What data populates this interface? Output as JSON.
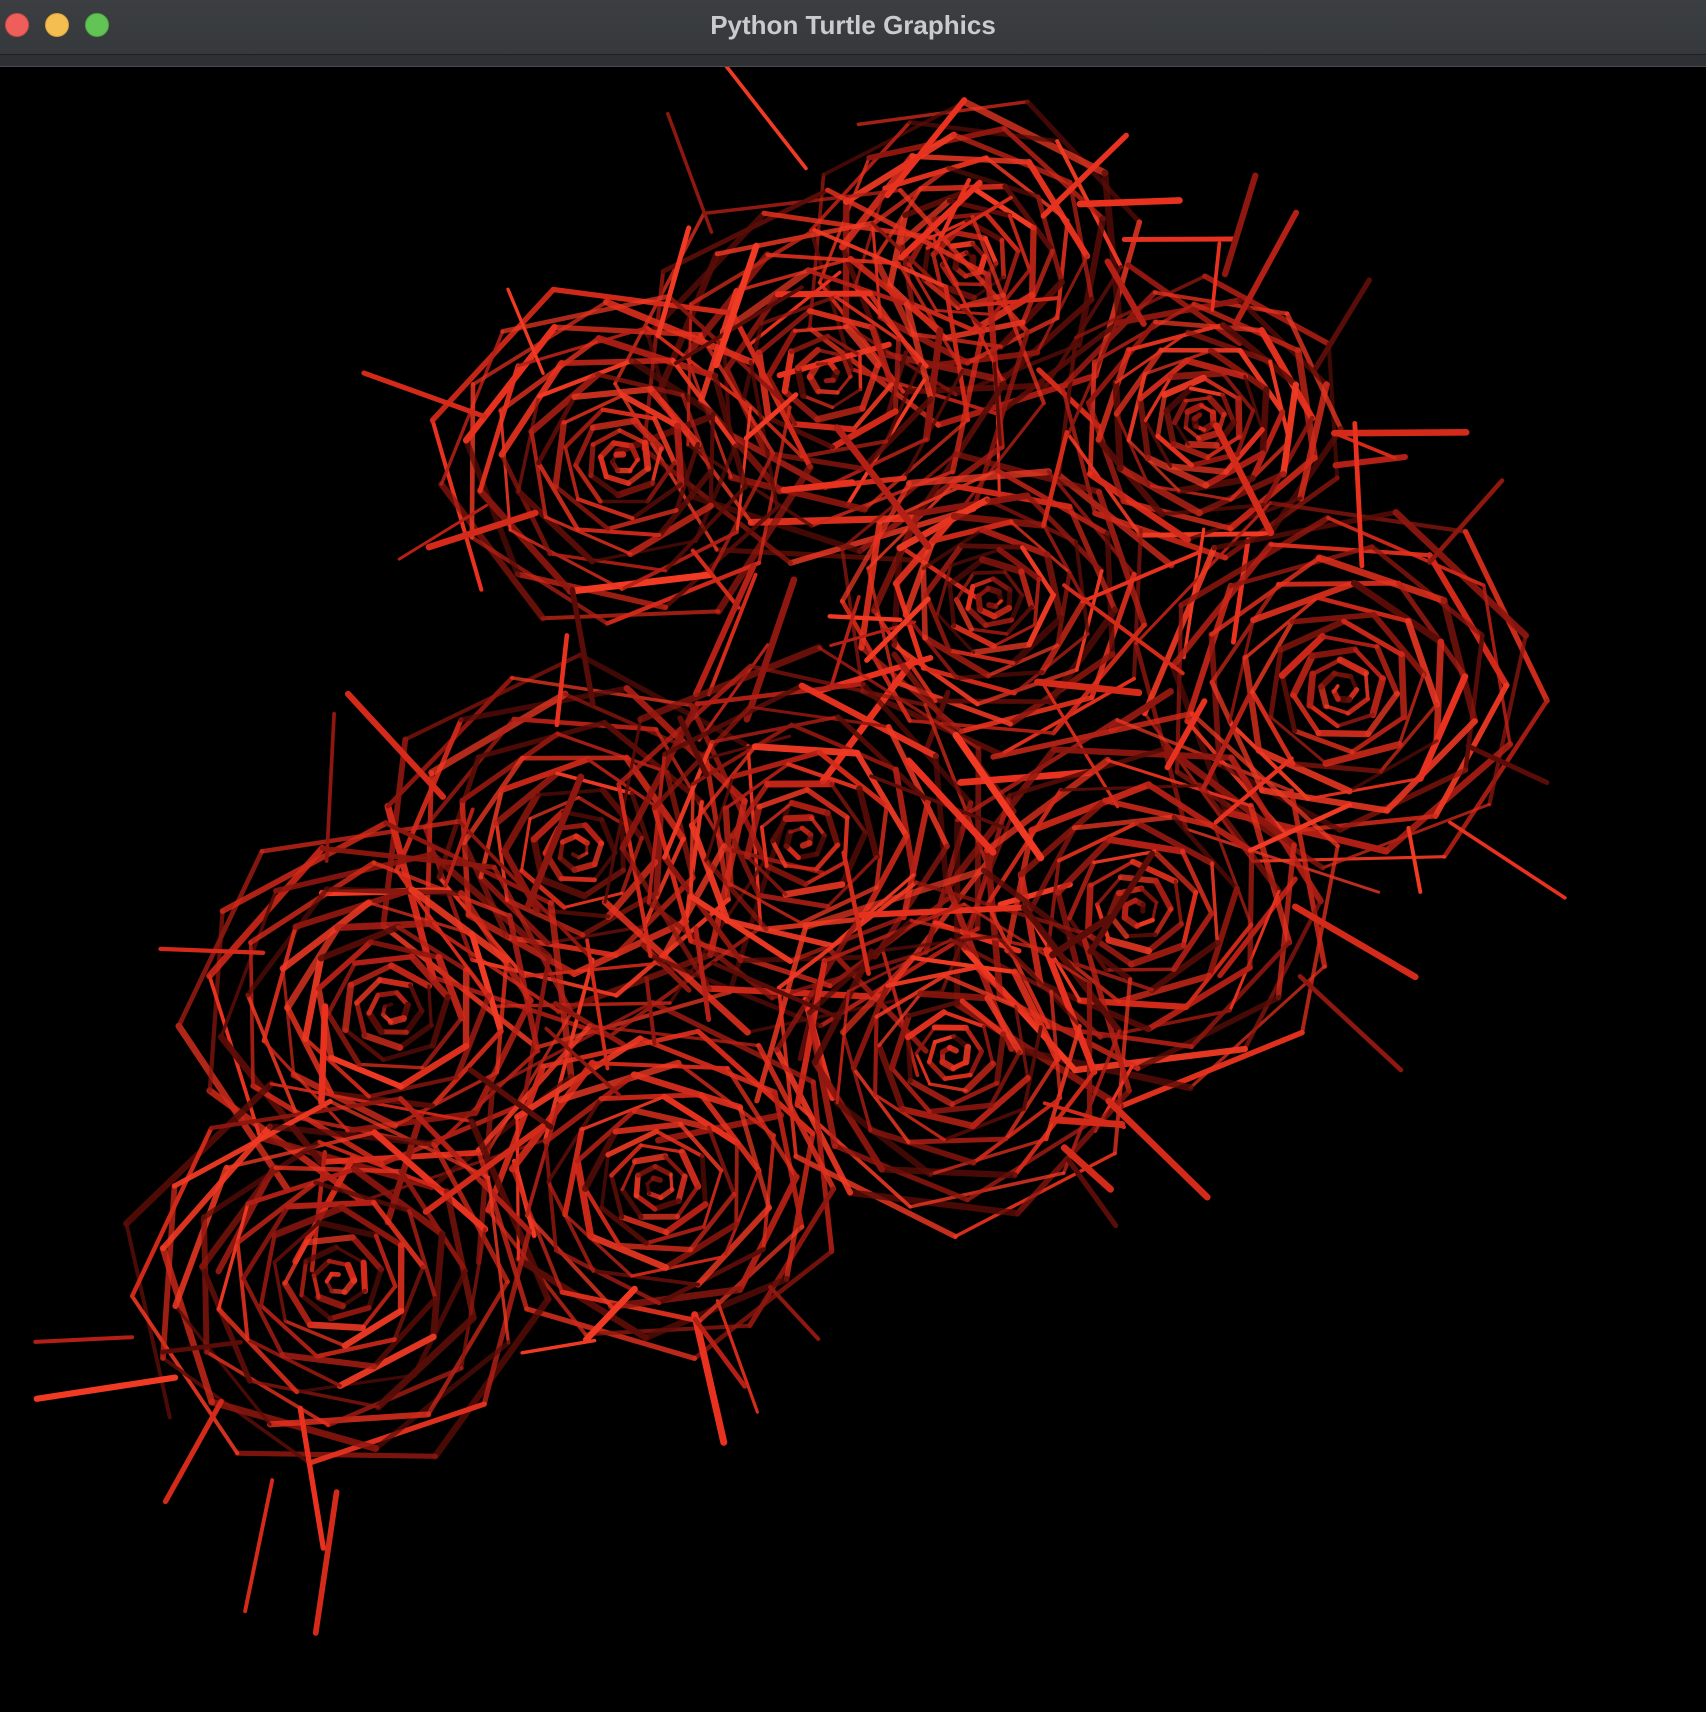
{
  "window": {
    "title": "Python Turtle Graphics"
  },
  "titlebar": {
    "buttons": [
      "close",
      "minimize",
      "zoom"
    ]
  },
  "colors": {
    "titlebar": "#383b3e",
    "canvas_background": "#000000",
    "stroke_bright": "#e8321f",
    "stroke_mid": "#b52016",
    "stroke_dark": "#5a0d08"
  },
  "drawing": {
    "subject": "roses",
    "flower_count": 13
  }
}
